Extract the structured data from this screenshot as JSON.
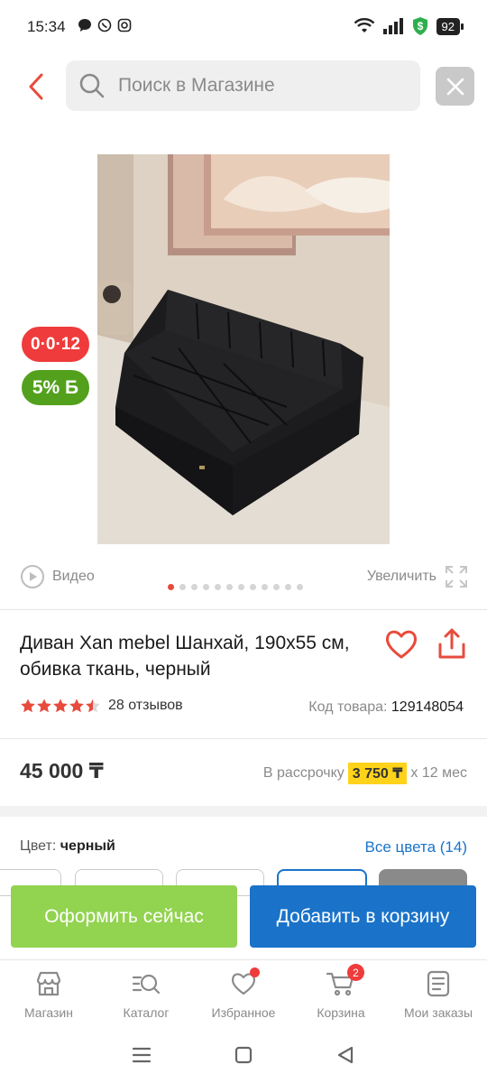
{
  "status_bar": {
    "time": "15:34",
    "battery": "92"
  },
  "header": {
    "search_placeholder": "Поиск в Магазине"
  },
  "badges": {
    "timer": "0·0·12",
    "bonus": "5% Б"
  },
  "media": {
    "video_label": "Видео",
    "zoom_label": "Увеличить",
    "image_count": 12,
    "active_image": 1
  },
  "product": {
    "title": "Диван Xan mebel Шанхай, 190x55 см, обивка ткань, черный",
    "rating": 4.5,
    "reviews": "28 отзывов",
    "sku_label": "Код товара:",
    "sku": "129148054",
    "price": "45 000 ₸",
    "installment_prefix": "В рассрочку",
    "installment_amount": "3 750 ₸",
    "installment_suffix": "х 12 мес",
    "color_label": "Цвет:",
    "color_value": "черный",
    "all_colors": "Все цвета (14)"
  },
  "actions": {
    "buy_now": "Оформить сейчас",
    "add_to_cart": "Добавить в корзину"
  },
  "tabbar": [
    {
      "label": "Магазин",
      "icon": "store-icon"
    },
    {
      "label": "Каталог",
      "icon": "catalog-search-icon"
    },
    {
      "label": "Избранное",
      "icon": "heart-icon"
    },
    {
      "label": "Корзина",
      "icon": "cart-icon",
      "badge": "2"
    },
    {
      "label": "Мои заказы",
      "icon": "orders-icon"
    }
  ],
  "colors": {
    "accent_red": "#e74b3c",
    "primary_blue": "#1a73c9",
    "buy_green": "#92d350",
    "installment_yellow": "#ffd31a"
  }
}
